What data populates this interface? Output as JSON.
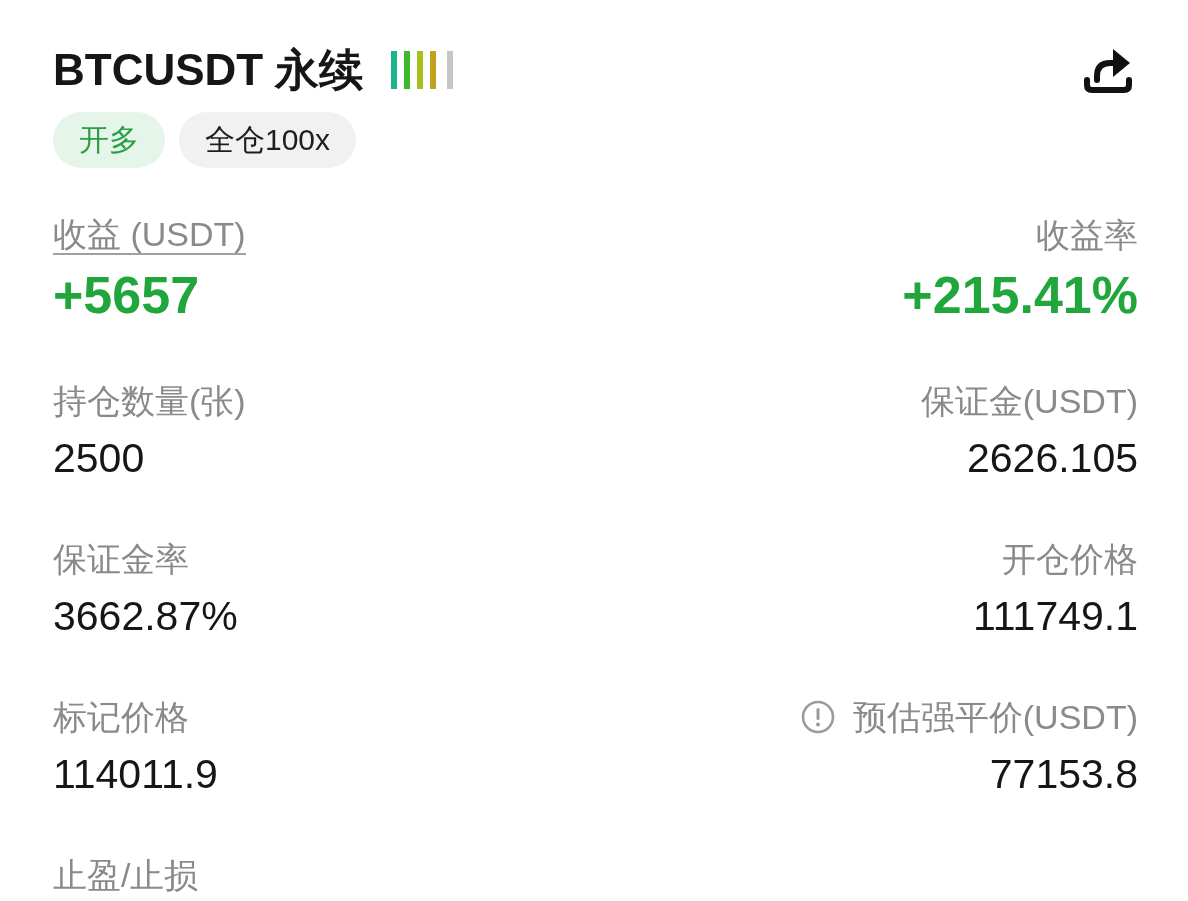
{
  "header": {
    "title": "BTCUSDT 永续"
  },
  "tags": [
    {
      "label": "开多",
      "kind": "side"
    },
    {
      "label": "全仓100x",
      "kind": "margin"
    }
  ],
  "fields": [
    {
      "label": "收益 (USDT)",
      "value": "+5657",
      "kind": "pnl",
      "underlined": true,
      "info": false
    },
    {
      "label": "收益率",
      "value": "+215.41%",
      "kind": "pnl",
      "underlined": false,
      "info": false
    },
    {
      "label": "持仓数量(张)",
      "value": "2500",
      "kind": "plain",
      "underlined": false,
      "info": false
    },
    {
      "label": "保证金(USDT)",
      "value": "2626.105",
      "kind": "plain",
      "underlined": false,
      "info": false
    },
    {
      "label": "保证金率",
      "value": "3662.87%",
      "kind": "plain",
      "underlined": false,
      "info": false
    },
    {
      "label": "开仓价格",
      "value": "111749.1",
      "kind": "plain",
      "underlined": false,
      "info": false
    },
    {
      "label": "标记价格",
      "value": "114011.9",
      "kind": "plain",
      "underlined": false,
      "info": false
    },
    {
      "label": "预估强平价(USDT)",
      "value": "77153.8",
      "kind": "plain",
      "underlined": false,
      "info": true
    },
    {
      "label": "止盈/止损",
      "underlined": false,
      "info": false
    }
  ]
}
